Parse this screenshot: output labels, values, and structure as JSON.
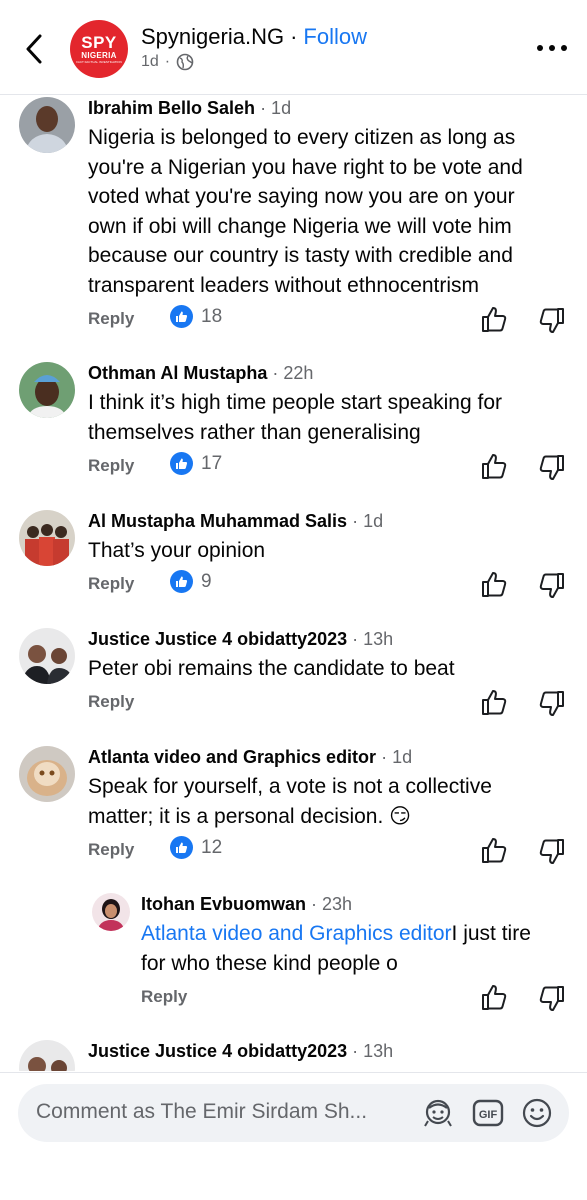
{
  "header": {
    "page_name": "Spynigeria.NG",
    "separator": "·",
    "follow_label": "Follow",
    "time": "1d",
    "logo": {
      "line1": "SPY",
      "line2": "NIGERIA",
      "tagline": "FACT FACTUAL INVESTIGATION",
      "color": "#e3262d"
    }
  },
  "comments": [
    {
      "author": "Ibrahim Bello Saleh",
      "time": "· 1d",
      "lines": [
        "Nigeria is belonged to every citizen as long as",
        "you're a Nigerian you have right to be vote and",
        "voted what you're saying now you are on your",
        "own if obi will change Nigeria we will vote him",
        "because our country is tasty with credible and",
        "transparent leaders without ethnocentrism"
      ],
      "reply_label": "Reply",
      "likes": "18"
    },
    {
      "author": "Othman Al Mustapha",
      "time": "· 22h",
      "lines": [
        "I think it’s high time people start speaking for",
        "themselves rather than generalising"
      ],
      "reply_label": "Reply",
      "likes": "17"
    },
    {
      "author": "Al Mustapha Muhammad Salis",
      "time": "· 1d",
      "lines": [
        "That’s your opinion"
      ],
      "reply_label": "Reply",
      "likes": "9"
    },
    {
      "author": "Justice Justice 4 obidatty2023",
      "time": "· 13h",
      "lines": [
        "Peter obi remains the candidate to beat"
      ],
      "reply_label": "Reply"
    },
    {
      "author": "Atlanta video and Graphics editor",
      "time": "· 1d",
      "lines": [
        "Speak for yourself, a vote is not a collective",
        "matter; it is a personal decision. 😏"
      ],
      "reply_label": "Reply",
      "likes": "12"
    },
    {
      "author": "Itohan Evbuomwan",
      "time": "· 23h",
      "mention": "Atlanta video and Graphics editor",
      "line1_rest": "I just tire",
      "line2": "for who these kind people o",
      "reply_label": "Reply"
    },
    {
      "author": "Justice Justice 4 obidatty2023",
      "time": "· 13h"
    }
  ],
  "footer": {
    "placeholder": "Comment as The Emir Sirdam Sh..."
  },
  "colors": {
    "accent": "#1877f2",
    "secondary_text": "#65676b"
  },
  "icons": [
    "back-icon",
    "globe-icon",
    "more-icon",
    "like-badge-icon",
    "thumbs-up-icon",
    "thumbs-down-icon",
    "avatar-frame-icon",
    "gif-icon",
    "emoji-icon"
  ]
}
